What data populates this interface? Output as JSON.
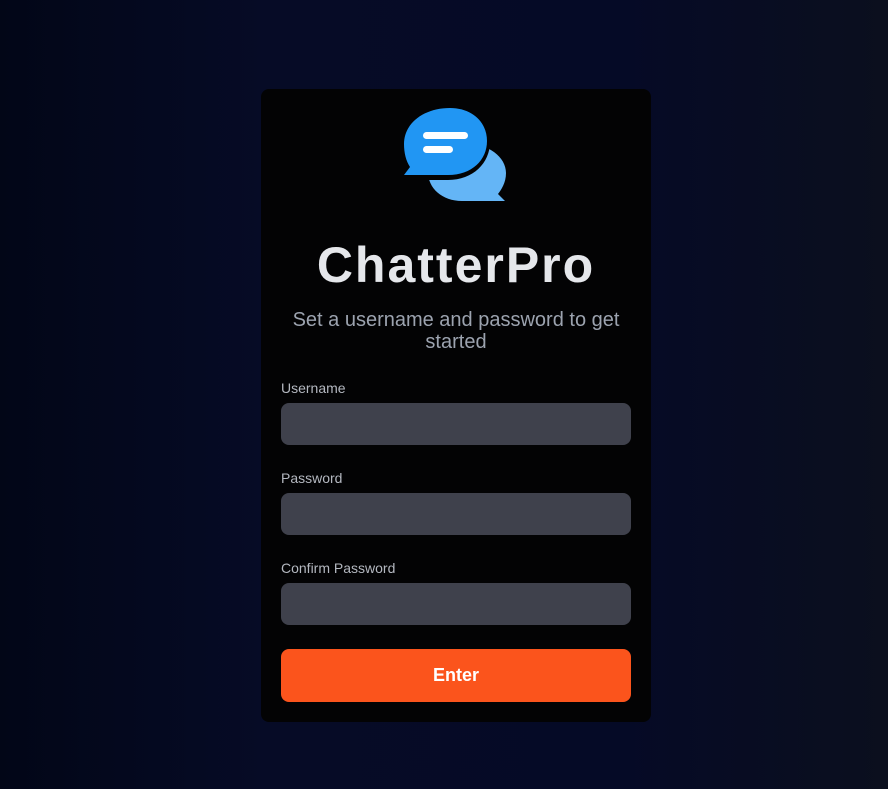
{
  "app": {
    "name": "ChatterPro",
    "subtitle": "Set a username and password to get started",
    "logo_icon": "chat-bubbles-icon"
  },
  "form": {
    "username": {
      "label": "Username",
      "value": "",
      "placeholder": ""
    },
    "password": {
      "label": "Password",
      "value": "",
      "placeholder": ""
    },
    "confirm_password": {
      "label": "Confirm Password",
      "value": "",
      "placeholder": ""
    },
    "submit_label": "Enter"
  },
  "colors": {
    "accent": "#fb541c",
    "logo_primary": "#2196f3",
    "logo_secondary": "#64b5f6",
    "card_background": "#030304",
    "input_background": "#3f414c"
  }
}
